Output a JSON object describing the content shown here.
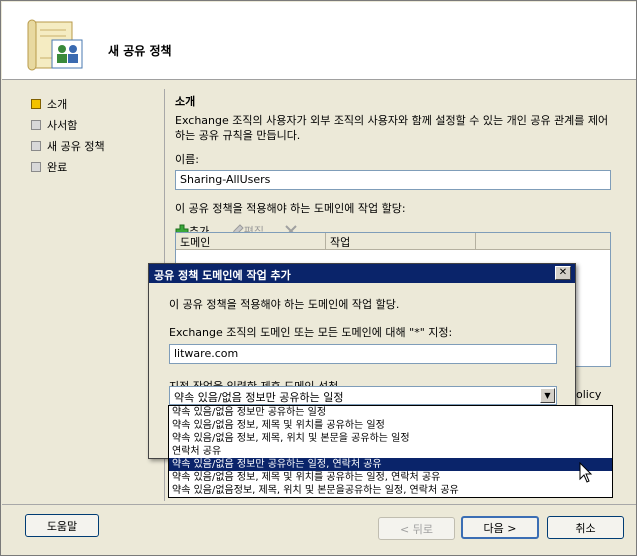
{
  "header": {
    "title": "새 공유 정책"
  },
  "nav": {
    "items": [
      {
        "label": "소개",
        "active": true
      },
      {
        "label": "사서함",
        "active": false
      },
      {
        "label": "새 공유 정책",
        "active": false
      },
      {
        "label": "완료",
        "active": false
      }
    ]
  },
  "content": {
    "section_title": "소개",
    "intro": "Exchange 조직의 사용자가 외부 조직의 사용자와 함께 설정할 수 있는 개인 공유 관계를 제어하는 공유 규칙을 만듭니다.",
    "name_label": "이름:",
    "name_value": "Sharing-AllUsers",
    "assign_label": "이 공유 정책을 적용해야 하는 도메인에 작업 할당:",
    "toolbar": {
      "add": "추가...",
      "edit": "편집...",
      "delete": ""
    },
    "columns": [
      "도메인",
      "작업"
    ],
    "policy_fragment": "olicy"
  },
  "dialog": {
    "title": "공유 정책 도메인에 작업 추가",
    "close": "✕",
    "desc": "이 공유 정책을 적용해야 하는 도메인에 작업 할당.",
    "domain_label": "Exchange 조직의 도메인 또는 모든 도메인에 대해 \"*\" 지정:",
    "domain_value": "litware.com",
    "action_label": "지정 작업을 입력한 제휴 도메인 선청",
    "combo_value": "약속 있음/없음 정보만 공유하는 일정"
  },
  "dropdown": {
    "options": [
      "약속 있음/없음 정보만 공유하는 일정",
      "약속 있음/없음 정보, 제목 및 위치를 공유하는 일정",
      "약속 있음/없음 정보, 제목, 위치 및 본문을 공유하는 일정",
      "연락처 공유",
      "약속 있음/없음 정보만 공유하는 일정, 연락처 공유",
      "약속 있음/없음 정보, 제목 및 위치를 공유하는 일정, 연락처 공유",
      "약속 있음/없음정보, 제목, 위치 및 본문을공유하는 일정, 연락처 공유"
    ],
    "selected_index": 4
  },
  "buttons": {
    "help": "도움말",
    "back": "< 뒤로",
    "next": "다음 >",
    "cancel": "취소"
  },
  "colors": {
    "titlebar": "#0a246a",
    "selection": "#0a246a",
    "nav_active": "#f2c200"
  }
}
